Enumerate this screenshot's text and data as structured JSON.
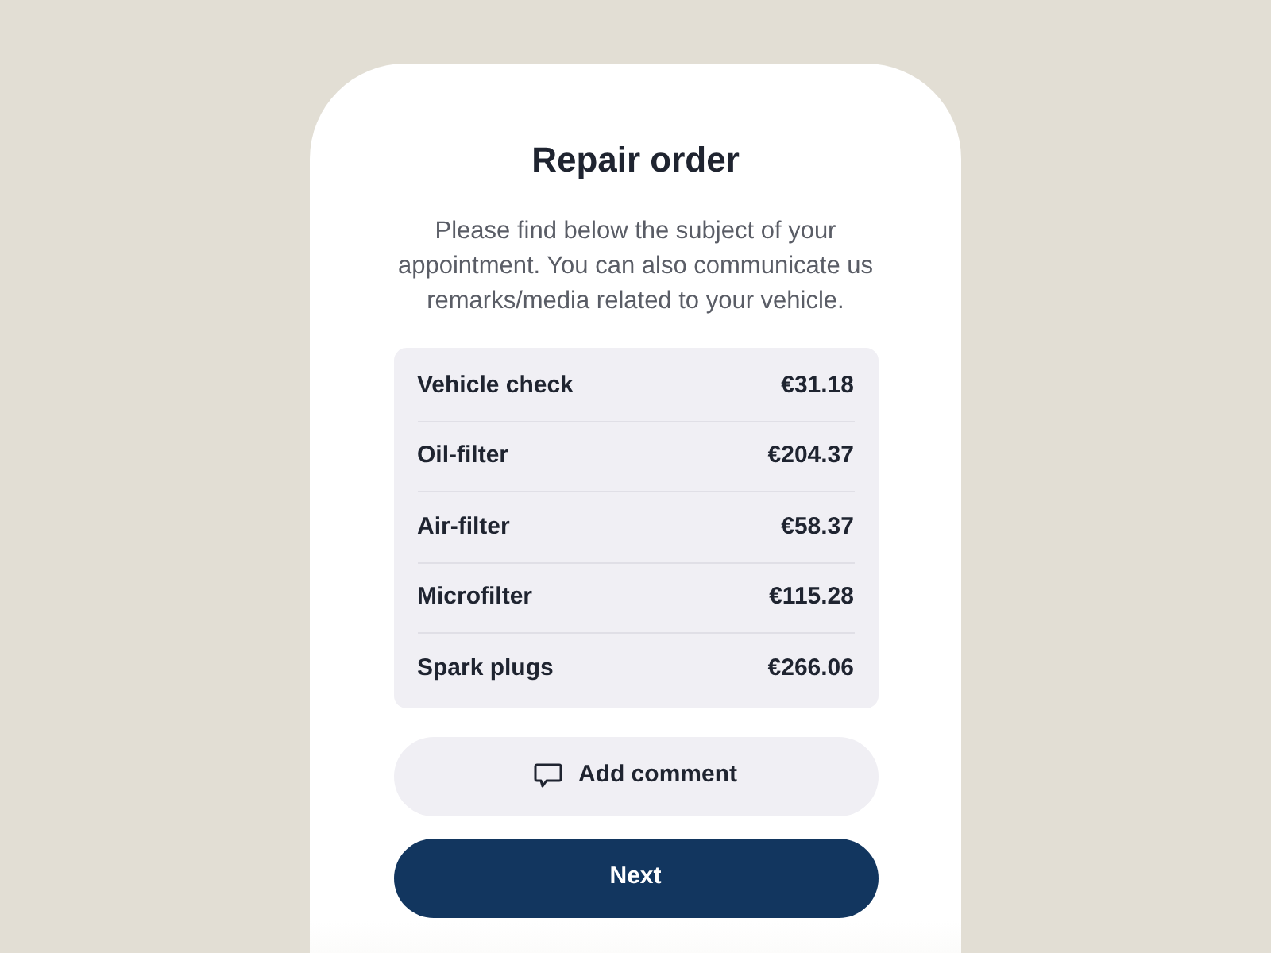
{
  "title": "Repair order",
  "description": "Please find below the subject of your appointment. You can also communicate us remarks/media related to your vehicle.",
  "items": [
    {
      "name": "Vehicle check",
      "price": "€31.18"
    },
    {
      "name": "Oil-filter",
      "price": "€204.37"
    },
    {
      "name": "Air-filter",
      "price": "€58.37"
    },
    {
      "name": "Microfilter",
      "price": "€115.28"
    },
    {
      "name": "Spark plugs",
      "price": "€266.06"
    }
  ],
  "comment_button": "Add comment",
  "next_button": "Next"
}
